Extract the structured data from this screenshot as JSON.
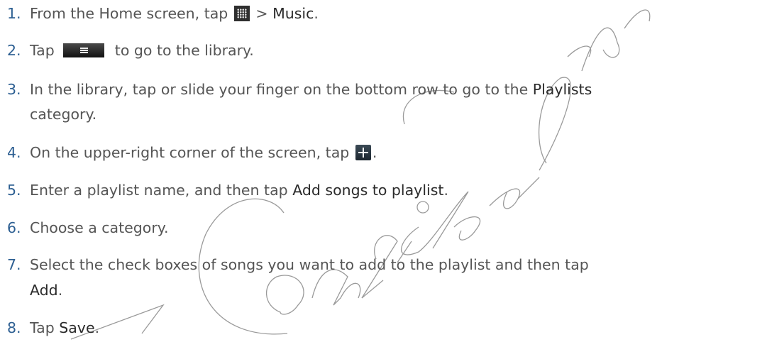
{
  "steps": [
    {
      "number": "1.",
      "before": "From the Home screen, tap",
      "icon": "all-apps-grid-icon",
      "middle": " > ",
      "term": "Music",
      "after": "."
    },
    {
      "number": "2.",
      "before": "Tap",
      "icon": "menu-bar-icon",
      "after": "to go to the library."
    },
    {
      "number": "3.",
      "line1_before": "In the library, tap or slide your finger on the bottom row to go to the ",
      "line1_term": "Playlists",
      "line2": "category."
    },
    {
      "number": "4.",
      "before": "On the upper-right corner of the screen, tap",
      "icon": "plus-icon",
      "after": "."
    },
    {
      "number": "5.",
      "before": "Enter a playlist name, and then tap ",
      "term": "Add songs to playlist",
      "after": "."
    },
    {
      "number": "6.",
      "text": "Choose a category."
    },
    {
      "number": "7.",
      "line1": "Select the check boxes of songs you want to add to the playlist and then tap",
      "line2_term": "Add",
      "line2_after": "."
    },
    {
      "number": "8.",
      "before": "Tap ",
      "term": "Save",
      "after": "."
    }
  ],
  "watermark": {
    "text": "HTC Confidential",
    "color": "#7a7a7a"
  }
}
